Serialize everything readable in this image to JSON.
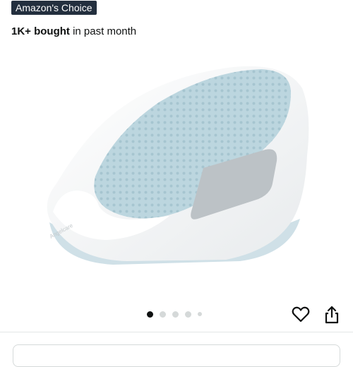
{
  "badge": {
    "label": "Amazon's Choice"
  },
  "purchase_stat": {
    "count": "1K+ bought",
    "suffix": " in past month"
  },
  "product_image": {
    "alt": "Angelcare baby bath support, white with light blue mesh seat",
    "brand_mark": "Angelcare"
  },
  "carousel": {
    "total": 5,
    "active_index": 0
  },
  "actions": {
    "favorite_icon": "heart-icon",
    "share_icon": "share-icon"
  },
  "colors": {
    "badge_bg": "#232f3e",
    "mesh": "#bcd6df",
    "tub": "#f6f7f8",
    "active_dot": "#0f1111",
    "inactive_dot": "#d5d9d9"
  }
}
